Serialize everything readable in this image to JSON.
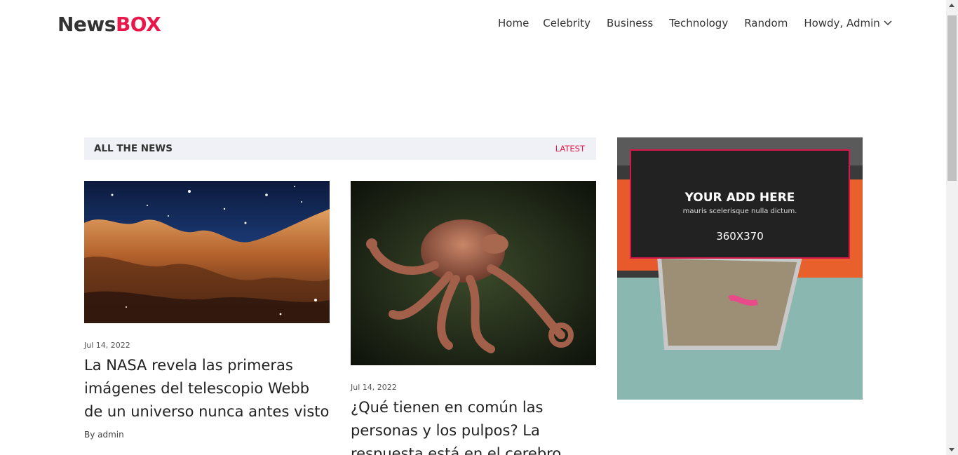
{
  "brand": {
    "part1": "News",
    "part2": "BOX",
    "accent": "#e8194a"
  },
  "nav": {
    "items": [
      "Home",
      "Celebrity",
      "Business",
      "Technology",
      "Random"
    ],
    "user_label": "Howdy, Admin"
  },
  "section": {
    "title": "ALL THE NEWS",
    "link": "LATEST"
  },
  "articles": [
    {
      "image": "nebula-image",
      "date": "Jul 14, 2022",
      "title": "La NASA revela las primeras imágenes del telescopio Webb de un universo nunca antes visto",
      "author": "By admin"
    },
    {
      "image": "octopus-image",
      "date": "Jul 14, 2022",
      "title": "¿Qué tienen en común las personas y los pulpos? La respuesta está en el cerebro"
    }
  ],
  "ad": {
    "title": "YOUR ADD HERE",
    "subtitle": "mauris scelerisque nulla dictum.",
    "size": "360X370"
  }
}
